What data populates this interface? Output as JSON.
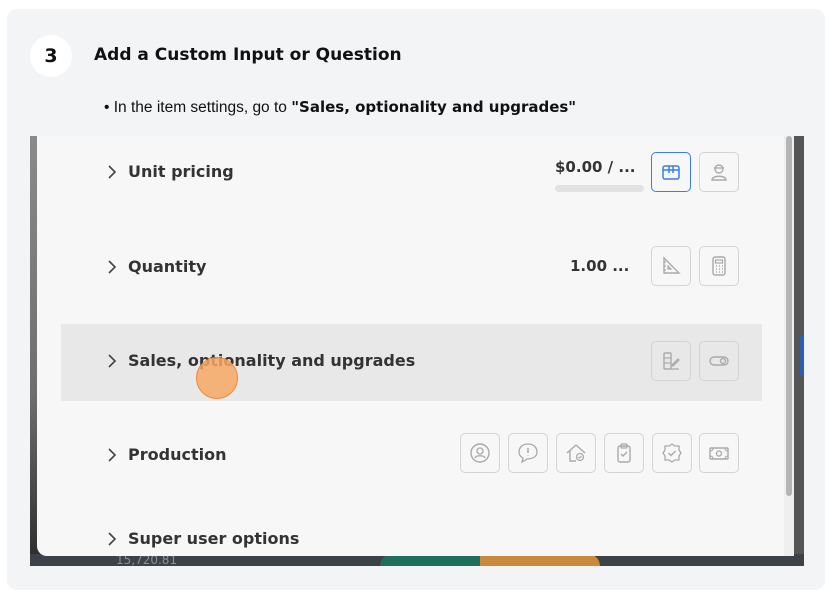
{
  "step": {
    "number": "3",
    "title": "Add a Custom Input or Question",
    "instruction_prefix": "• In the item settings, go to ",
    "instruction_target": "\"Sales, optionality and upgrades\""
  },
  "background": {
    "partial_number": "15,720.81"
  },
  "rows": [
    {
      "label": "Unit pricing",
      "value": "$0.00 / ...",
      "icons": [
        "box-icon",
        "worker-icon"
      ],
      "active_icon": "box-icon"
    },
    {
      "label": "Quantity",
      "value": "1.00 ...",
      "icons": [
        "ruler-triangle-icon",
        "calculator-icon"
      ]
    },
    {
      "label": "Sales, optionality and upgrades",
      "highlighted": true,
      "icons": [
        "options-icon",
        "toggle-icon"
      ]
    },
    {
      "label": "Production",
      "icons": [
        "person-circle-icon",
        "alert-bubble-icon",
        "home-check-icon",
        "clipboard-check-icon",
        "badge-check-icon",
        "cash-icon"
      ]
    },
    {
      "label": "Super user options"
    }
  ],
  "colors": {
    "accent_blue": "#3a7fe0",
    "click_marker": "#f6a864",
    "highlight_row": "#e8e8e8"
  }
}
